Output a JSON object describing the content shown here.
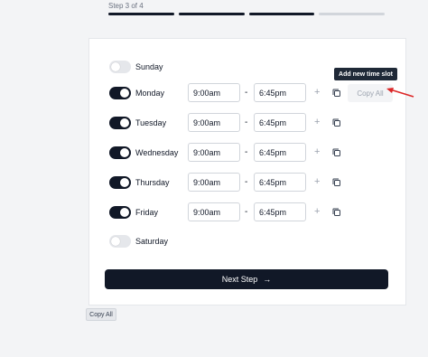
{
  "header": {
    "step_label": "Step 3 of 4",
    "progress_segments": [
      true,
      true,
      true,
      false
    ]
  },
  "days": [
    {
      "name": "Sunday",
      "enabled": false,
      "start": "",
      "end": ""
    },
    {
      "name": "Monday",
      "enabled": true,
      "start": "9:00am",
      "end": "6:45pm"
    },
    {
      "name": "Tuesday",
      "enabled": true,
      "start": "9:00am",
      "end": "6:45pm"
    },
    {
      "name": "Wednesday",
      "enabled": true,
      "start": "9:00am",
      "end": "6:45pm"
    },
    {
      "name": "Thursday",
      "enabled": true,
      "start": "9:00am",
      "end": "6:45pm"
    },
    {
      "name": "Friday",
      "enabled": true,
      "start": "9:00am",
      "end": "6:45pm"
    },
    {
      "name": "Saturday",
      "enabled": false,
      "start": "",
      "end": ""
    }
  ],
  "separator": "-",
  "plus_symbol": "+",
  "copy_all_label": "Copy All",
  "tooltip_label": "Add new time slot",
  "next_button_label": "Next Step",
  "next_button_arrow": "→",
  "floating_copy_all_label": "Copy All",
  "colors": {
    "accent": "#111827",
    "annotation_arrow": "#dc2626"
  }
}
